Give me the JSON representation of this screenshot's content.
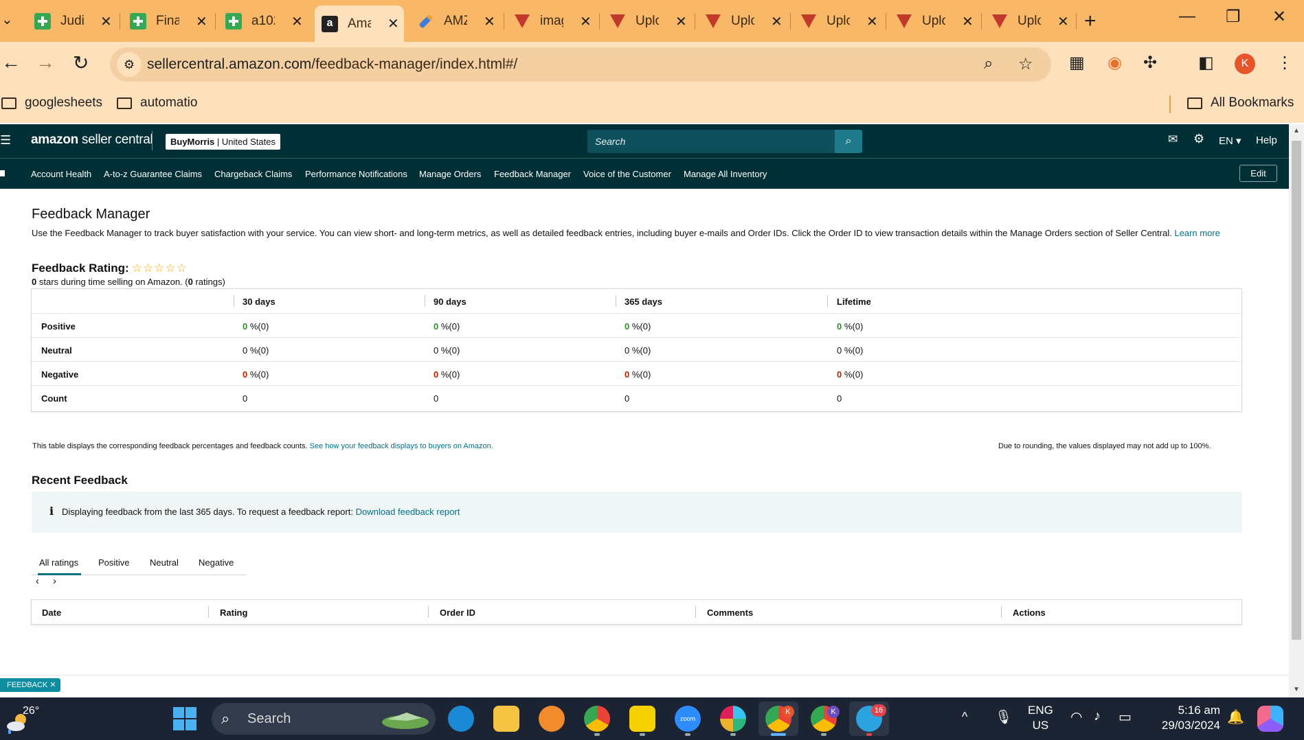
{
  "browser": {
    "tabs": [
      {
        "label": "Judi",
        "icon": "sheets-icon"
      },
      {
        "label": "Fina",
        "icon": "sheets-icon"
      },
      {
        "label": "a102",
        "icon": "sheets-icon"
      },
      {
        "label": "Ama",
        "icon": "amazon-icon",
        "active": true
      },
      {
        "label": "AMZ",
        "icon": "pen-icon"
      },
      {
        "label": "imag",
        "icon": "shield-icon"
      },
      {
        "label": "Uplo",
        "icon": "shield-icon"
      },
      {
        "label": "Uplo",
        "icon": "shield-icon"
      },
      {
        "label": "Uplo",
        "icon": "shield-icon"
      },
      {
        "label": "Uplo",
        "icon": "shield-icon"
      },
      {
        "label": "Uplo",
        "icon": "shield-icon"
      }
    ],
    "url_host": "sellercentral.amazon.com",
    "url_path": "/feedback-manager/index.html#/",
    "profile_initial": "K",
    "bookmarks": [
      "googlesheets",
      "automatio"
    ],
    "all_bookmarks": "All Bookmarks"
  },
  "header": {
    "logo_brand": "amazon",
    "logo_suffix": " seller central",
    "store_name": "BuyMorris",
    "store_region": " | United States",
    "search_placeholder": "Search",
    "language": "EN",
    "help": "Help"
  },
  "nav": {
    "items": [
      "Account Health",
      "A-to-z Guarantee Claims",
      "Chargeback Claims",
      "Performance Notifications",
      "Manage Orders",
      "Feedback Manager",
      "Voice of the Customer",
      "Manage All Inventory"
    ],
    "edit": "Edit"
  },
  "page": {
    "title": "Feedback Manager",
    "intro": "Use the Feedback Manager to track buyer satisfaction with your service. You can view short- and long-term metrics, as well as detailed feedback entries, including buyer e-mails and Order IDs. Click the Order ID to view transaction details within the Manage Orders section of Seller Central.",
    "learn_more": "Learn more",
    "rating_title": "Feedback Rating:",
    "rating_stars": "☆☆☆☆☆",
    "rating_value": "0",
    "rating_text_mid": " stars during time selling on Amazon. (",
    "rating_count": "0",
    "rating_text_end": " ratings)",
    "metrics": {
      "columns": [
        "30 days",
        "90 days",
        "365 days",
        "Lifetime"
      ],
      "rows": [
        {
          "label": "Positive",
          "values": [
            {
              "num": "0",
              "rest": " %(0)"
            },
            {
              "num": "0",
              "rest": " %(0)"
            },
            {
              "num": "0",
              "rest": " %(0)"
            },
            {
              "num": "0",
              "rest": " %(0)"
            }
          ],
          "color": "#2e8b2e"
        },
        {
          "label": "Neutral",
          "values": [
            {
              "num": "0",
              "rest": " %(0)"
            },
            {
              "num": "0",
              "rest": " %(0)"
            },
            {
              "num": "0",
              "rest": " %(0)"
            },
            {
              "num": "0",
              "rest": " %(0)"
            }
          ],
          "color": "#0f1111"
        },
        {
          "label": "Negative",
          "values": [
            {
              "num": "0",
              "rest": " %(0)"
            },
            {
              "num": "0",
              "rest": " %(0)"
            },
            {
              "num": "0",
              "rest": " %(0)"
            },
            {
              "num": "0",
              "rest": " %(0)"
            }
          ],
          "color": "#b12704"
        },
        {
          "label": "Count",
          "values": [
            {
              "num": "0",
              "rest": ""
            },
            {
              "num": "0",
              "rest": ""
            },
            {
              "num": "0",
              "rest": ""
            },
            {
              "num": "0",
              "rest": ""
            }
          ],
          "color": "#0f1111"
        }
      ]
    },
    "note_left": "This table displays the corresponding feedback percentages and feedback counts.",
    "note_left_link": "See how your feedback displays to buyers on Amazon.",
    "note_right": "Due to rounding, the values displayed may not add up to 100%.",
    "recent_title": "Recent Feedback",
    "info_text": "Displaying feedback from the last 365 days. To request a feedback report:",
    "info_link": "Download feedback report",
    "filter_tabs": [
      "All ratings",
      "Positive",
      "Neutral",
      "Negative"
    ],
    "feedback_columns": [
      "Date",
      "Rating",
      "Order ID",
      "Comments",
      "Actions"
    ],
    "feedback_pill": "FEEDBACK ✕"
  },
  "taskbar": {
    "temperature": "26°",
    "search": "Search",
    "lang_1": "ENG",
    "lang_2": "US",
    "time": "5:16 am",
    "date": "29/03/2024",
    "chrome_badge": "K",
    "chrome2_badge": "K",
    "telegram_badge": "16"
  },
  "colors": {
    "tab_strip": "#f9b768",
    "toolbar": "#fde1bd",
    "amazon_header": "#002f36",
    "link": "#007185",
    "positive": "#2e8b2e",
    "negative": "#b12704"
  }
}
